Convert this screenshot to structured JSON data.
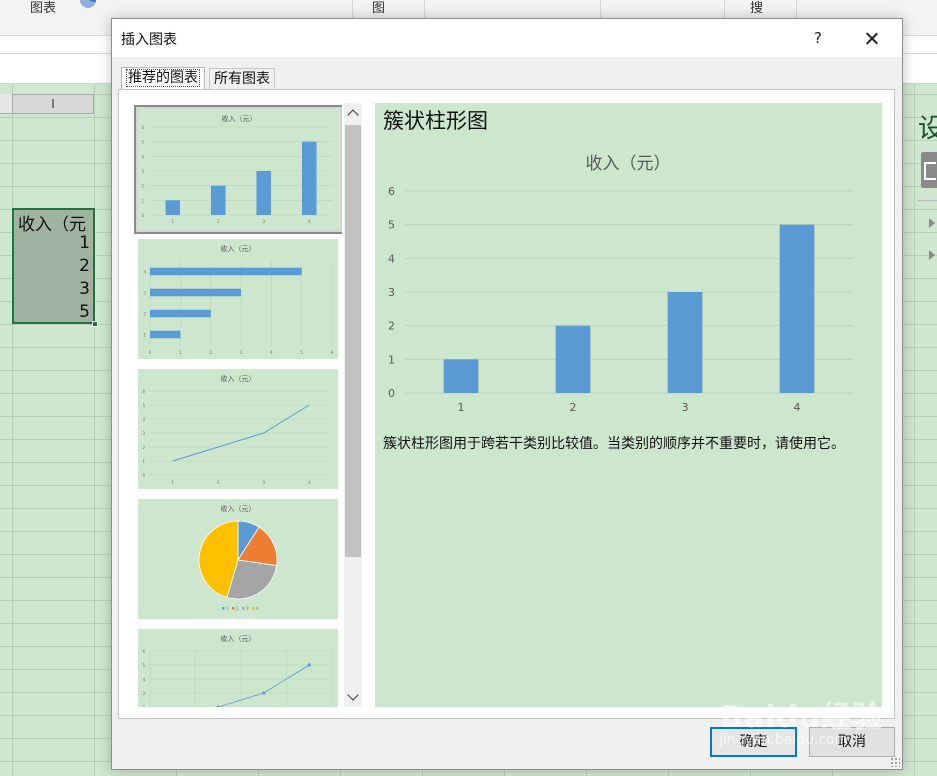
{
  "background": {
    "ribbon": {
      "chart_group_label": "图表",
      "label_2": "图",
      "label_3": "搜"
    },
    "column_header": "I",
    "cells": [
      "收入（元",
      "1",
      "2",
      "3",
      "5"
    ],
    "right_pane_title": "设"
  },
  "dialog": {
    "title": "插入图表",
    "help": "?",
    "tabs": [
      {
        "label": "推荐的图表",
        "active": true
      },
      {
        "label": "所有图表",
        "active": false
      }
    ],
    "thumbnail_title": "收入（元）",
    "selected_chart_name": "簇状柱形图",
    "description": "簇状柱形图用于跨若干类别比较值。当类别的顺序并不重要时，请使用它。",
    "ok_label": "确定",
    "cancel_label": "取消"
  },
  "colors": {
    "bar": "#5b9bd5",
    "pie": [
      "#5b9bd5",
      "#ed7d31",
      "#a5a5a5",
      "#ffc000"
    ],
    "chart_bg": "#cde6ce",
    "selection_border": "#217346"
  },
  "watermark": {
    "brand": "Baidu经验",
    "url": "jingyan.baidu.com"
  },
  "chart_data": {
    "type": "bar",
    "title": "收入（元）",
    "categories": [
      "1",
      "2",
      "3",
      "4"
    ],
    "values": [
      1,
      2,
      3,
      5
    ],
    "ylim": [
      0,
      6
    ],
    "yticks": [
      0,
      1,
      2,
      3,
      4,
      5,
      6
    ],
    "grid": true,
    "xlabel": "",
    "ylabel": ""
  }
}
